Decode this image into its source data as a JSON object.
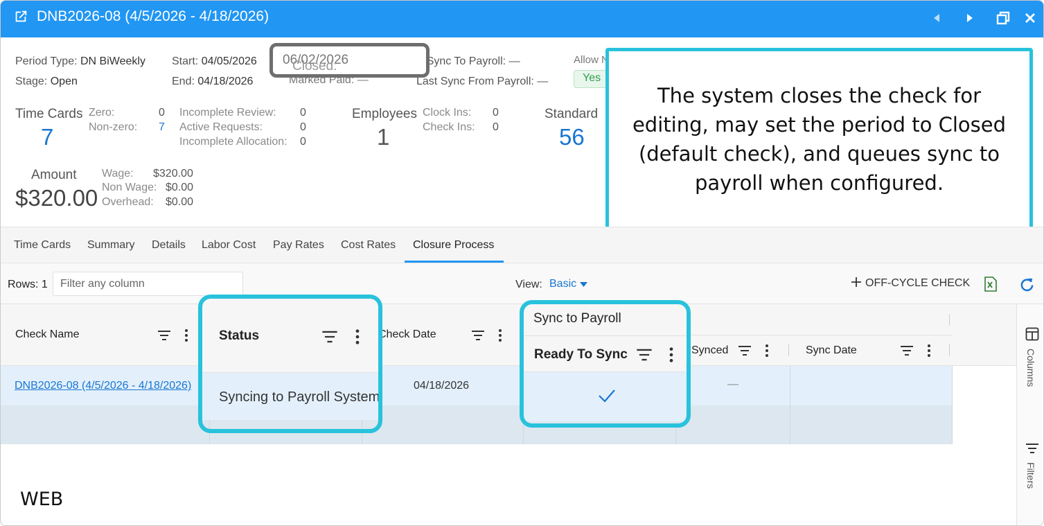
{
  "window": {
    "title": "DNB2026-08 (4/5/2026 - 4/18/2026)"
  },
  "period": {
    "period_type_label": "Period Type:",
    "period_type_value": "DN BiWeekly",
    "stage_label": "Stage:",
    "stage_value": "Open",
    "start_label": "Start:",
    "start_value": "04/05/2026",
    "end_label": "End:",
    "end_value": "04/18/2026",
    "closed_label": "Closed:",
    "closed_value": "06/02/2026",
    "marked_paid_label": "Marked Paid:",
    "marked_paid_value": "—",
    "last_sync_to_label": "Last Sync To Payroll:",
    "last_sync_to_value": "—",
    "last_sync_from_label": "Last Sync From Payroll:",
    "last_sync_from_value": "—",
    "allow_label": "Allow N",
    "allow_value": "Yes"
  },
  "stats": {
    "time_cards_label": "Time Cards",
    "time_cards_value": "7",
    "zero_label": "Zero:",
    "zero_value": "0",
    "nonzero_label": "Non-zero:",
    "nonzero_value": "7",
    "incomplete_review_label": "Incomplete Review:",
    "incomplete_review_value": "0",
    "active_requests_label": "Active Requests:",
    "active_requests_value": "0",
    "incomplete_allocation_label": "Incomplete Allocation:",
    "incomplete_allocation_value": "0",
    "employees_label": "Employees",
    "employees_value": "1",
    "clock_ins_label": "Clock Ins:",
    "clock_ins_value": "0",
    "check_ins_label": "Check Ins:",
    "check_ins_value": "0",
    "standard_label": "Standard",
    "standard_value": "56",
    "amount_label": "Amount",
    "amount_value": "$320.00",
    "wage_label": "Wage:",
    "wage_value": "$320.00",
    "non_wage_label": "Non Wage:",
    "non_wage_value": "$0.00",
    "overhead_label": "Overhead:",
    "overhead_value": "$0.00"
  },
  "callout": {
    "text": "The system closes the check for editing, may set the period to Closed (default check), and queues sync to payroll when configured."
  },
  "tabs": [
    "Time Cards",
    "Summary",
    "Details",
    "Labor Cost",
    "Pay Rates",
    "Cost Rates",
    "Closure Process"
  ],
  "toolbar": {
    "rows_label": "Rows: 1",
    "filter_placeholder": "Filter any column",
    "view_label": "View:",
    "view_value": "Basic",
    "off_cycle_label": "OFF-CYCLE CHECK"
  },
  "grid": {
    "columns": {
      "check_name": "Check Name",
      "status": "Status",
      "check_date": "Check Date",
      "sync_group": "Sync to Payroll",
      "ready_to_sync": "Ready To Sync",
      "synced": "Synced",
      "sync_date": "Sync Date"
    },
    "rows": [
      {
        "check_name": "DNB2026-08 (4/5/2026 - 4/18/2026)",
        "status": "Syncing to Payroll System",
        "check_date": "04/18/2026",
        "ready_to_sync": true,
        "synced": "—",
        "sync_date": ""
      }
    ]
  },
  "sidebar": {
    "columns_label": "Columns",
    "filters_label": "Filters"
  },
  "footer_label": "WEB",
  "colors": {
    "accent": "#2196f3",
    "highlight": "#29c2dc",
    "closed_border": "#6e6e6e",
    "yes_green": "#2e9e50"
  }
}
